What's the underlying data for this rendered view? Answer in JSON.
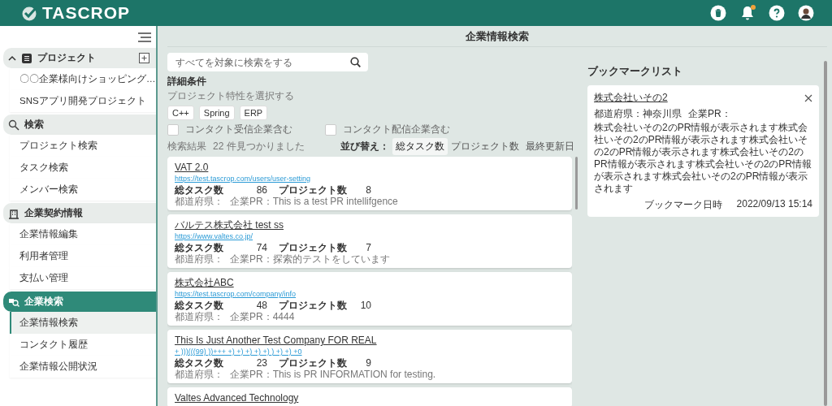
{
  "header": {
    "logo": "TASCROP",
    "notification_badge": true
  },
  "sidebar": {
    "sections": [
      {
        "title": "プロジェクト",
        "expanded": true,
        "selected": false,
        "items": [
          {
            "label": "〇〇企業様向けショッピング…",
            "selected": false
          },
          {
            "label": "SNSアプリ開発プロジェクト",
            "selected": false
          }
        ]
      },
      {
        "title": "検索",
        "selected": false,
        "items": [
          {
            "label": "プロジェクト検索",
            "selected": false
          },
          {
            "label": "タスク検索",
            "selected": false
          },
          {
            "label": "メンバー検索",
            "selected": false
          }
        ]
      },
      {
        "title": "企業契約情報",
        "selected": false,
        "items": [
          {
            "label": "企業情報編集",
            "selected": false
          },
          {
            "label": "利用者管理",
            "selected": false
          },
          {
            "label": "支払い管理",
            "selected": false
          }
        ]
      },
      {
        "title": "企業検索",
        "selected": true,
        "items": [
          {
            "label": "企業情報検索",
            "selected": true
          },
          {
            "label": "コンタクト履歴",
            "selected": false
          },
          {
            "label": "企業情報公開状況",
            "selected": false
          }
        ]
      }
    ]
  },
  "page_title": "企業情報検索",
  "search": {
    "placeholder": "すべてを対象に検索をする"
  },
  "filters": {
    "heading": "詳細条件",
    "subheading": "プロジェクト特性を選択する",
    "tags": [
      "C++",
      "Spring",
      "ERP"
    ],
    "checkboxes": [
      {
        "label": "コンタクト受信企業含む",
        "checked": false
      },
      {
        "label": "コンタクト配信企業含む",
        "checked": false
      }
    ]
  },
  "results": {
    "label": "検索結果",
    "count": "22 件見つかりました"
  },
  "sort": {
    "label": "並び替え：",
    "options": [
      {
        "label": "総タスク数",
        "selected": true
      },
      {
        "label": "プロジェクト数",
        "selected": false
      },
      {
        "label": "最終更新日",
        "selected": false
      }
    ]
  },
  "companies": [
    {
      "name": "VAT 2.0",
      "url": "https://test.tascrop.com/users/user-setting",
      "task_label": "総タスク数",
      "task_count": "86",
      "project_label": "プロジェクト数",
      "project_count": "8",
      "pref_label": "都道府県：",
      "pr": "企業PR：This is a test PR intellifgence"
    },
    {
      "name": "バルテス株式会社 test ss",
      "url": "https://www.valtes.co.jp/",
      "task_label": "総タスク数",
      "task_count": "74",
      "project_label": "プロジェクト数",
      "project_count": "7",
      "pref_label": "都道府県：",
      "pr": "企業PR：探索的テストをしています"
    },
    {
      "name": "株式会社ABC",
      "url": "https://test.tascrop.com/company/info",
      "task_label": "総タスク数",
      "task_count": "48",
      "project_label": "プロジェクト数",
      "project_count": "10",
      "pref_label": "都道府県：",
      "pr": "企業PR：4444"
    },
    {
      "name": "This Is Just Another Test Company FOR REAL",
      "url": "+ )))(((99) ))+++ +) +) +) +) +) ) +) +) +0",
      "task_label": "総タスク数",
      "task_count": "23",
      "project_label": "プロジェクト数",
      "project_count": "9",
      "pref_label": "都道府県：",
      "pr": "企業PR：This is PR INFORMATION for testing."
    },
    {
      "name": "Valtes Advanced Technology"
    }
  ],
  "bookmarks": {
    "title": "ブックマークリスト",
    "items": [
      {
        "name": "株式会社いその2",
        "pref": "都道府県：神奈川県",
        "pr_label": "企業PR：",
        "pr": "株式会社いその2のPR情報が表示されます株式会社いその2のPR情報が表示されます株式会社いその2のPR情報が表示されます株式会社いその2のPR情報が表示されます株式会社いその2のPR情報が表示されます株式会社いその2のPR情報が表示されます",
        "date_label": "ブックマーク日時",
        "date": "2022/09/13 15:14"
      }
    ]
  }
}
